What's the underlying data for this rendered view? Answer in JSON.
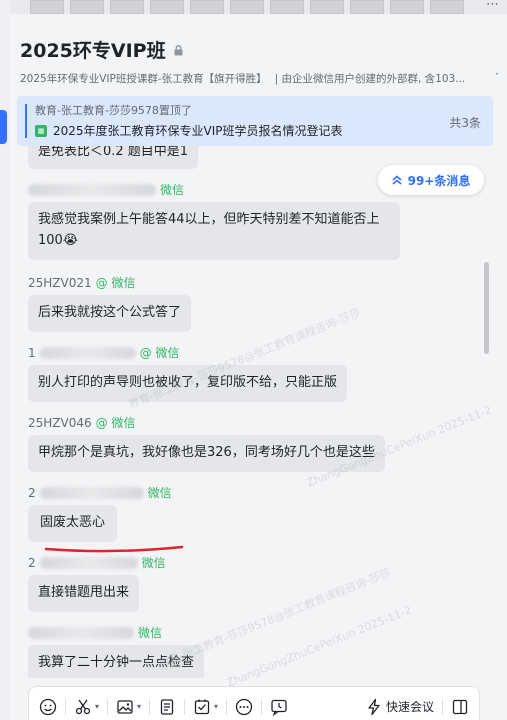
{
  "chat": {
    "title": "2025环专VIP班",
    "subtitle_parts": [
      "2025年环保专业VIP班授课群-张工教育【旗开得胜】",
      "| 由企业微信用户创建的外部群, 含103..."
    ],
    "more": "·"
  },
  "pinned": {
    "who": "教育-张工教育-莎莎9578置顶了",
    "doc_title": "2025年度张工教育环保专业VIP班学员报名情况登记表",
    "count": "共3条"
  },
  "unread": {
    "label": "99+条消息"
  },
  "messages": [
    {
      "sender": "",
      "source": "微信",
      "text": "是免表比＜0.2  题目中是1"
    },
    {
      "sender": "",
      "source": "微信",
      "text": "我感觉我案例上午能答44以上，但昨天特别差不知道能否上100😭"
    },
    {
      "sender": "25HZV021",
      "source": "@ 微信",
      "text": "后来我就按这个公式答了"
    },
    {
      "sender": "1",
      "source": "@ 微信",
      "text": "别人打印的声导则也被收了，复印版不给，只能正版"
    },
    {
      "sender": "25HZV046",
      "source": "@ 微信",
      "text": "甲烷那个是真坑，我好像也是326，同考场好几个也是这些"
    },
    {
      "sender": "2",
      "source": "微信",
      "text": "固废太恶心"
    },
    {
      "sender": "2",
      "source": "微信",
      "text": "直接错题甩出来"
    },
    {
      "sender": "",
      "source": "微信",
      "text": "我算了二十分钟一点点检查"
    }
  ],
  "watermark": {
    "line1": "教育-张工教育-莎莎9578@张工教育课程咨询-莎莎",
    "line2": "ZhangGongZhuCePeiXun 2025-11-2"
  },
  "toolbar": {
    "meeting_label": "快速会议"
  },
  "colors": {
    "accent": "#3370ff",
    "wechat": "#34b466",
    "bubble": "#e4e6ea",
    "pinned_bg": "#dbe8fb"
  }
}
